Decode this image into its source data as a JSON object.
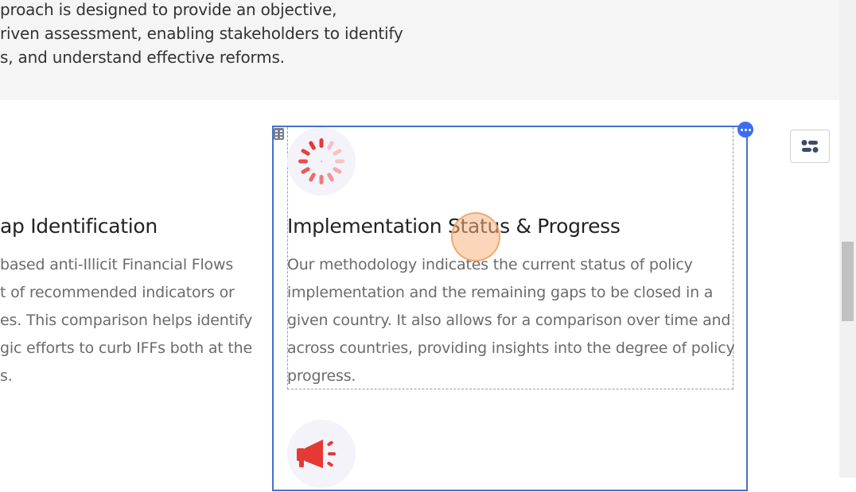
{
  "intro": {
    "lines": [
      "proach is designed to provide an objective,",
      "riven assessment, enabling stakeholders to identify",
      "s, and understand effective reforms."
    ]
  },
  "left_card": {
    "title": "ap Identification",
    "lines": [
      "based anti-Illicit Financial Flows",
      "t of recommended indicators or",
      "es. This comparison helps identify",
      "gic efforts to curb IFFs both at the",
      "s."
    ]
  },
  "selected_card": {
    "icon": "loading-spinner-icon",
    "title": "Implementation Status & Progress",
    "lines": [
      "Our methodology indicates the current status of policy",
      "implementation and the remaining gaps to be closed in a",
      "given country. It also allows for a comparison over time and",
      "across countries, providing insights into the degree of policy",
      "progress."
    ]
  },
  "next_card": {
    "icon": "megaphone-icon"
  },
  "colors": {
    "selection_border": "#4a6fce",
    "accent_blue": "#3b6ff0",
    "icon_red": "#e53935",
    "cursor_highlight": "#f5b27f"
  }
}
